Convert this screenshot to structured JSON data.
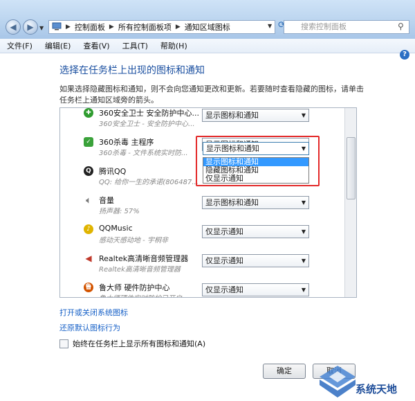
{
  "address": {
    "segments": [
      "控制面板",
      "所有控制面板项",
      "通知区域图标"
    ]
  },
  "search": {
    "placeholder": "搜索控制面板"
  },
  "menu": [
    {
      "label": "文件(F)"
    },
    {
      "label": "编辑(E)"
    },
    {
      "label": "查看(V)"
    },
    {
      "label": "工具(T)"
    },
    {
      "label": "帮助(H)"
    }
  ],
  "page": {
    "heading": "选择在任务栏上出现的图标和通知",
    "description": "如果选择隐藏图标和通知，则不会向您通知更改和更新。若要随时查看隐藏的图标，请单击任务栏上通知区域旁的箭头。"
  },
  "icons": [
    {
      "name": "360安全卫士 安全防护中心...",
      "sub": "360安全卫士 - 安全防护中心...",
      "behavior": "显示图标和通知",
      "icon": "360-safe-icon",
      "color": "#2f9c2f"
    },
    {
      "name": "360杀毒 主程序",
      "sub": "360杀毒 - 文件系统实时防...",
      "behavior": "显示图标和通知",
      "icon": "360-antivirus-icon",
      "color": "#3aa23a"
    },
    {
      "name": "腾讯QQ",
      "sub": "QQ: 给你一生的承诺(806487...",
      "behavior": "",
      "icon": "qq-penguin-icon",
      "color": "#222222"
    },
    {
      "name": "音量",
      "sub": "扬声器: 57%",
      "behavior": "显示图标和通知",
      "icon": "speaker-icon",
      "color": "#8a8a8a"
    },
    {
      "name": "QQMusic",
      "sub": "感动天感动地 - 宇桐非",
      "behavior": "仅显示通知",
      "icon": "qqmusic-icon",
      "color": "#e0b400"
    },
    {
      "name": "Realtek高清晰音频管理器",
      "sub": "Realtek高清晰音频管理器",
      "behavior": "仅显示通知",
      "icon": "realtek-speaker-icon",
      "color": "#c0392b"
    },
    {
      "name": "鲁大师 硬件防护中心",
      "sub": "鲁大师硬件实时防护已开启",
      "behavior": "仅显示通知",
      "icon": "ludashi-icon",
      "color": "#d35400"
    }
  ],
  "dropdown": {
    "options": [
      "显示图标和通知",
      "隐藏图标和通知",
      "仅显示通知"
    ],
    "highlighted": "显示图标和通知"
  },
  "links": {
    "system_icons": "打开或关闭系统图标",
    "restore": "还原默认图标行为"
  },
  "always_show": {
    "label": "始终在任务栏上显示所有图标和通知(A)",
    "checked": false
  },
  "buttons": {
    "ok": "确定",
    "cancel": "取消"
  },
  "watermark": {
    "text": "系统天地"
  }
}
